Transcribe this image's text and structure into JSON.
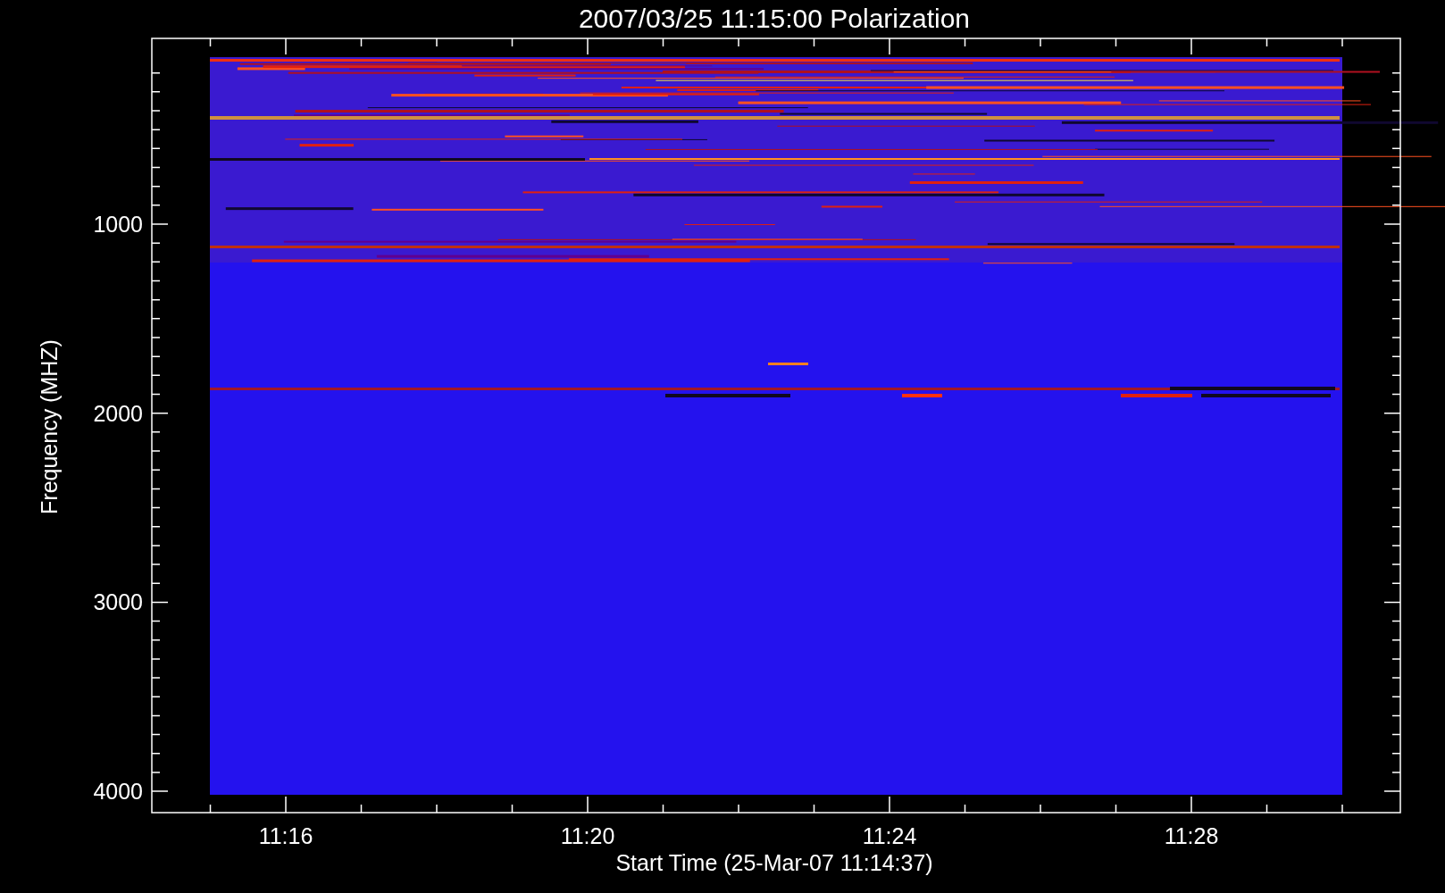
{
  "title": "2007/03/25 11:15:00 Polarization",
  "y_axis": {
    "label": "Frequency (MHZ)",
    "ticks": [
      "1000",
      "2000",
      "3000",
      "4000"
    ]
  },
  "x_axis": {
    "label": "Start Time (25-Mar-07 11:14:37)",
    "ticks": [
      "11:16",
      "11:20",
      "11:24",
      "11:28"
    ]
  }
}
